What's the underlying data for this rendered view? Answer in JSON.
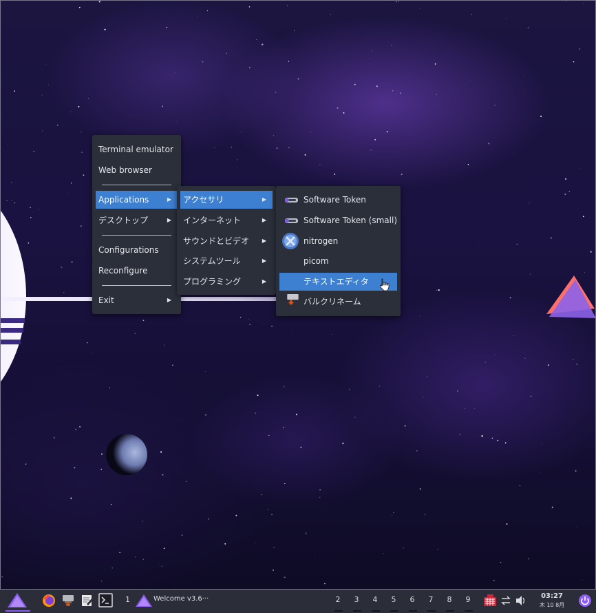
{
  "colors": {
    "menu_bg": "#2a2f3a",
    "highlight": "#3d7fd0",
    "taskbar_bg": "#2b2e39",
    "accent_purple": "#8b5cf6"
  },
  "root_menu": {
    "items": [
      {
        "label": "Terminal emulator"
      },
      {
        "label": "Web browser"
      },
      {
        "label": "Applications",
        "submenu": true,
        "active": true
      },
      {
        "label": "デスクトップ",
        "submenu": true
      },
      {
        "label": "Configurations"
      },
      {
        "label": "Reconfigure"
      },
      {
        "label": "Exit",
        "submenu": true
      }
    ]
  },
  "applications_menu": {
    "items": [
      {
        "label": "アクセサリ",
        "submenu": true,
        "active": true
      },
      {
        "label": "インターネット",
        "submenu": true
      },
      {
        "label": "サウンドとビデオ",
        "submenu": true
      },
      {
        "label": "システムツール",
        "submenu": true
      },
      {
        "label": "プログラミング",
        "submenu": true
      }
    ]
  },
  "accessories_menu": {
    "items": [
      {
        "label": "Software Token",
        "icon": "token-icon"
      },
      {
        "label": "Software Token (small)",
        "icon": "token-icon"
      },
      {
        "label": "nitrogen",
        "icon": "nitrogen-icon"
      },
      {
        "label": "picom",
        "icon": ""
      },
      {
        "label": "テキストエディタ",
        "icon": "",
        "active": true
      },
      {
        "label": "バルクリネーム",
        "icon": "bulk-rename-icon"
      }
    ]
  },
  "taskbar": {
    "launchers": [
      "app-menu-icon",
      "firefox-icon",
      "file-manager-icon",
      "text-editor-icon",
      "terminal-icon"
    ],
    "current_workspace": "1",
    "window_title": "Welcome v3.6···",
    "workspaces": [
      "2",
      "3",
      "4",
      "5",
      "6",
      "7",
      "8",
      "9"
    ],
    "tray": [
      "keyboard-icon",
      "network-icon",
      "volume-icon"
    ],
    "clock_time": "03:27",
    "clock_date": "木 10 8月",
    "power_icon": "power-icon"
  }
}
